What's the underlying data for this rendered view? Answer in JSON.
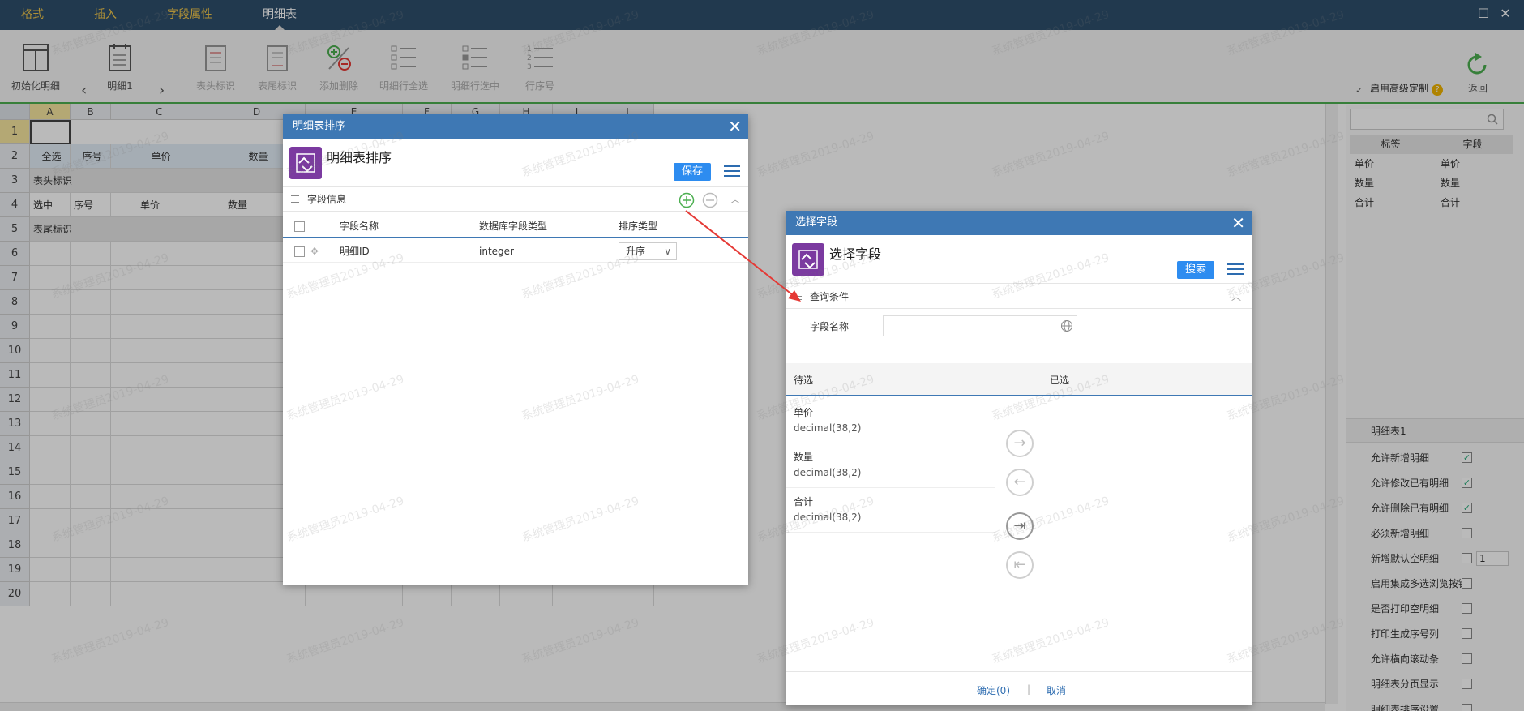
{
  "menu": {
    "tabs": [
      {
        "label": "格式"
      },
      {
        "label": "插入"
      },
      {
        "label": "字段属性"
      },
      {
        "label": "明细表"
      }
    ],
    "active_tab": "明细表",
    "window_buttons": {
      "maximize": "☐",
      "close": "✕"
    }
  },
  "toolbar": {
    "init": "初始化明细",
    "detail": "明细1",
    "prev": "‹",
    "next": "›",
    "header_mark": "表头标识",
    "footer_mark": "表尾标识",
    "add_remove": "添加删除",
    "select_all_rows": "明细行全选",
    "select_row": "明细行选中",
    "row_number": "行序号",
    "advanced_label": "启用高级定制",
    "advanced_help": "?",
    "back": "返回"
  },
  "sheet": {
    "columns": [
      "A",
      "B",
      "C",
      "D",
      "E",
      "F",
      "G",
      "H",
      "I",
      "J"
    ],
    "rows": [
      "1",
      "2",
      "3",
      "4",
      "5",
      "6",
      "7",
      "8",
      "9",
      "10",
      "11",
      "12",
      "13",
      "14",
      "15",
      "16",
      "17",
      "18",
      "19",
      "20"
    ],
    "row2": [
      "全选",
      "序号",
      "单价",
      "数量"
    ],
    "row3": "表头标识",
    "row4": [
      "选中",
      "序号",
      "单价",
      "数量"
    ],
    "row5": "表尾标识"
  },
  "right_panel": {
    "headers": [
      "标签",
      "字段"
    ],
    "rows": [
      {
        "label": "单价",
        "field": "单价"
      },
      {
        "label": "数量",
        "field": "数量"
      },
      {
        "label": "合计",
        "field": "合计"
      }
    ],
    "section": "明细表1",
    "props": [
      {
        "label": "允许新增明细",
        "checked": true
      },
      {
        "label": "允许修改已有明细",
        "checked": true
      },
      {
        "label": "允许删除已有明细",
        "checked": true
      },
      {
        "label": "必须新增明细",
        "checked": false
      },
      {
        "label": "新增默认空明细",
        "checked": false,
        "value": "1"
      },
      {
        "label": "启用集成多选浏览按钮",
        "checked": false
      },
      {
        "label": "是否打印空明细",
        "checked": false
      },
      {
        "label": "打印生成序号列",
        "checked": false
      },
      {
        "label": "允许横向滚动条",
        "checked": false
      },
      {
        "label": "明细表分页显示",
        "checked": false
      },
      {
        "label": "明细表排序设置",
        "checked": false
      }
    ]
  },
  "sort_dialog": {
    "title": "明细表排序",
    "name": "明细表排序",
    "save": "保存",
    "section": "字段信息",
    "columns": [
      "字段名称",
      "数据库字段类型",
      "排序类型"
    ],
    "rows": [
      {
        "name": "明细ID",
        "type": "integer",
        "sort": "升序"
      }
    ],
    "close": "✕"
  },
  "select_dialog": {
    "title": "选择字段",
    "name": "选择字段",
    "search": "搜索",
    "section": "查询条件",
    "field_label": "字段名称",
    "field_value": "",
    "pending_label": "待选",
    "selected_label": "已选",
    "candidates": [
      {
        "name": "单价",
        "type": "decimal(38,2)"
      },
      {
        "name": "数量",
        "type": "decimal(38,2)"
      },
      {
        "name": "合计",
        "type": "decimal(38,2)"
      }
    ],
    "confirm": "确定(0)",
    "separator": "|",
    "cancel": "取消",
    "close": "✕"
  },
  "watermark": "系统管理员2019-04-29",
  "colors": {
    "menubar": "#2e4f6c",
    "menu_tab": "#f0c64a",
    "dialog_title": "#3e78b4",
    "button_blue": "#2d8cf0",
    "logo_purple": "#7b3aa0",
    "arrow_red": "#e53935",
    "toolbar_accent": "#4caf50"
  }
}
